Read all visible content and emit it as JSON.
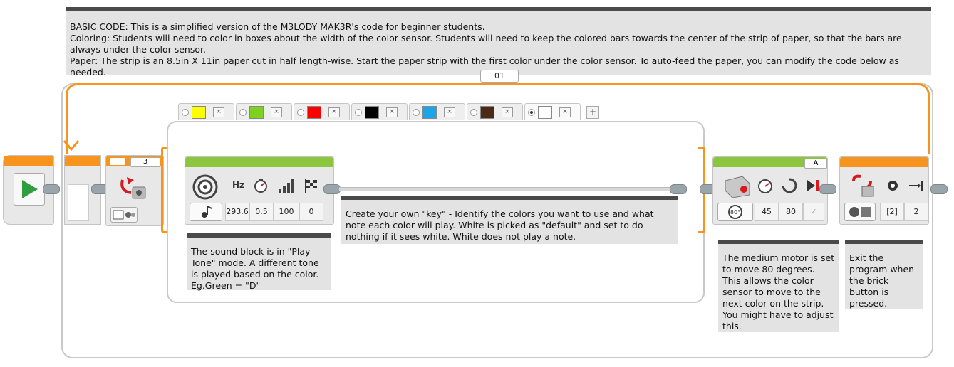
{
  "top_comment": {
    "line1": "BASIC CODE: This is a simplified version of the M3LODY MAK3R's code for beginner students.",
    "line2": "Coloring: Students will need to color in boxes about the width of the color sensor. Students will need to keep the colored bars towards the center of the strip of paper, so that the bars are always under the color sensor.",
    "line3": "Paper: The strip is an 8.5in X 11in paper cut in half length-wise. Start the paper strip with the first color under the color sensor. To auto-feed the paper, you can modify the code below as needed."
  },
  "loop": {
    "counter": "01"
  },
  "switch_block": {
    "port": "3",
    "cases": [
      {
        "color": "#ffff00",
        "selected": false
      },
      {
        "color": "#7fd11f",
        "selected": false
      },
      {
        "color": "#ff0000",
        "selected": false
      },
      {
        "color": "#000000",
        "selected": false
      },
      {
        "color": "#1aa5e8",
        "selected": false
      },
      {
        "color": "#4a2a16",
        "selected": false
      },
      {
        "color": "#ffffff",
        "selected": true
      }
    ],
    "case_delete": "×",
    "add_case": "+"
  },
  "sound_block": {
    "hz_label": "Hz",
    "frequency": "293.6",
    "duration": "0.5",
    "volume": "100",
    "play_type": "0"
  },
  "motor_block": {
    "port": "A",
    "power": "45",
    "degrees": "80"
  },
  "stop_block": {
    "button": "[2]",
    "state": "2"
  },
  "comments": {
    "sound": "The sound block is in \"Play Tone\" mode. A different tone is played based on the color. Eg.Green = \"D\"",
    "key": "Create your own \"key\" - Identify the colors you want to use and what note each color will play. White is picked as \"default\" and set to do nothing if it sees white. White does not play a note.",
    "motor": "The medium motor is set to move 80 degrees. This allows the color sensor to move to the next color on the strip. You might have to adjust this.",
    "exit": "Exit the program when the brick button is pressed."
  },
  "colors": {
    "orange": "#f7941d",
    "green": "#8cc63f",
    "comment_bg": "#e3e3e3"
  }
}
